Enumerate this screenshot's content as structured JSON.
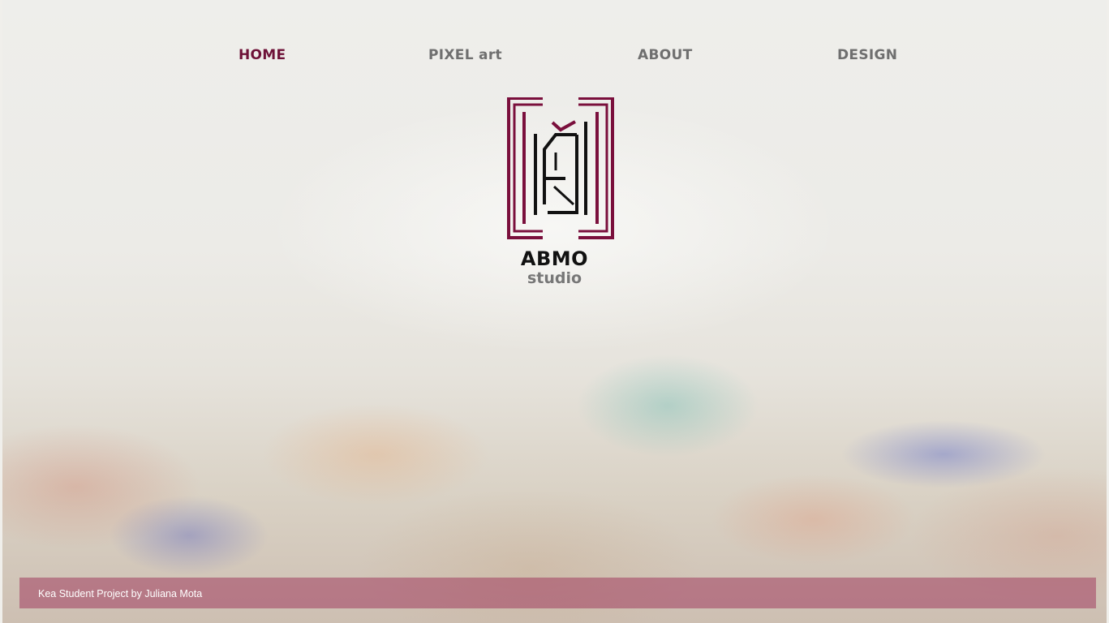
{
  "nav": {
    "items": [
      {
        "label": "HOME",
        "active": true
      },
      {
        "label": "PIXEL art",
        "active": false
      },
      {
        "label": "ABOUT",
        "active": false
      },
      {
        "label": "DESIGN",
        "active": false
      }
    ]
  },
  "brand": {
    "name": "ABMO",
    "subtitle": "studio",
    "logo_icon": "abmo-monogram-logo"
  },
  "footer": {
    "credit": "Kea Student Project by Juliana Mota"
  },
  "colors": {
    "accent": "#6e1238",
    "nav_text": "#6f6f6f",
    "footer_bar": "#a03c5f"
  }
}
